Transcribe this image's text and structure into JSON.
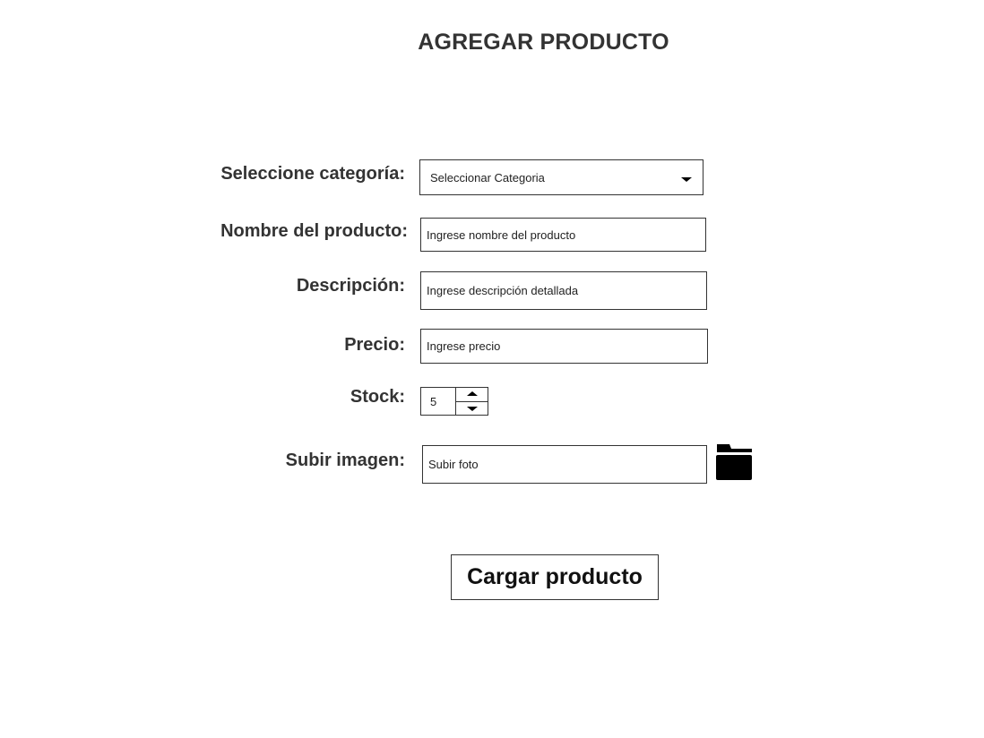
{
  "page": {
    "title": "AGREGAR PRODUCTO"
  },
  "form": {
    "category": {
      "label": "Seleccione categoría:",
      "selected": "Seleccionar Categoria"
    },
    "name": {
      "label": "Nombre del producto:",
      "placeholder": "Ingrese nombre del producto"
    },
    "description": {
      "label": "Descripción:",
      "placeholder": "Ingrese descripción detallada"
    },
    "price": {
      "label": "Precio:",
      "placeholder": "Ingrese precio"
    },
    "stock": {
      "label": "Stock:",
      "value": "5"
    },
    "image": {
      "label": "Subir imagen:",
      "placeholder": "Subir foto",
      "icon": "folder-icon"
    },
    "submit_label": "Cargar producto"
  }
}
